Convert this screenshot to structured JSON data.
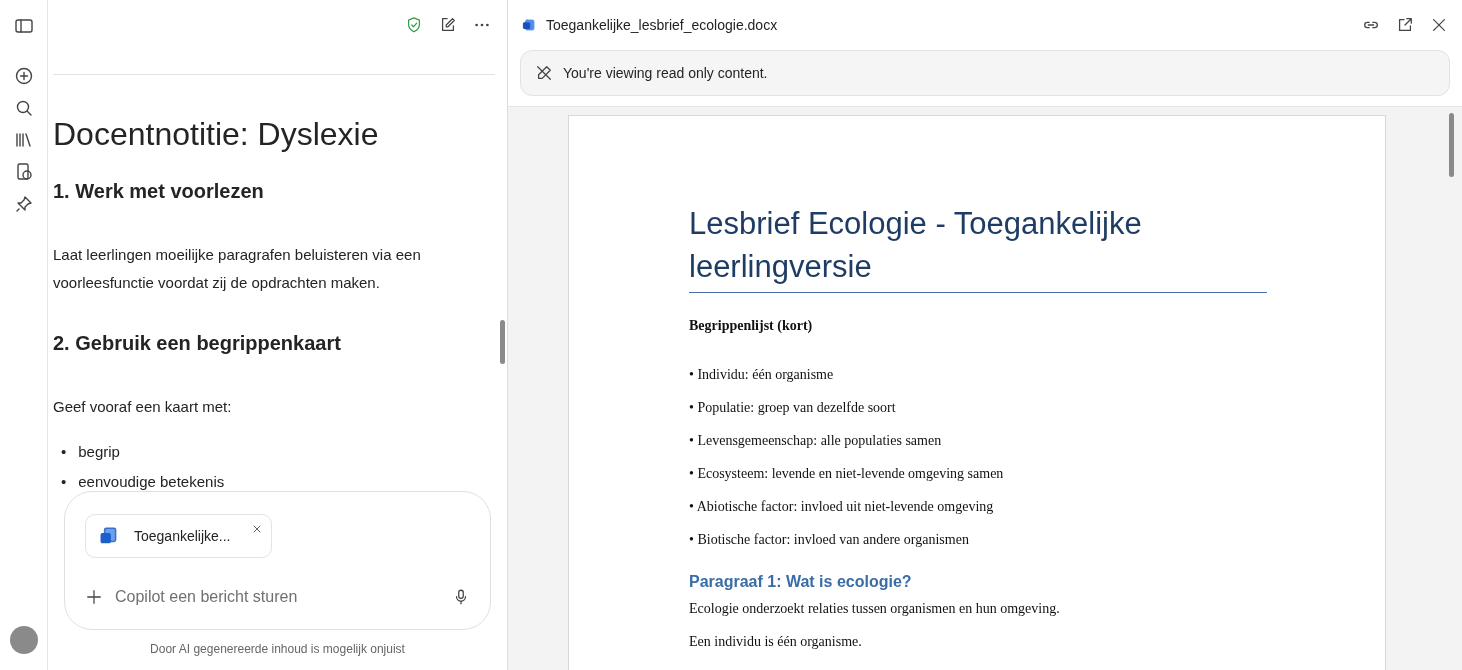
{
  "notes": {
    "title": "Docentnotitie: Dyslexie",
    "blocks": [
      {
        "kind": "heading",
        "text": "1. Werk met voorlezen"
      },
      {
        "kind": "paragraph",
        "text": "Laat leerlingen moeilijke paragrafen beluisteren via een voorleesfunctie voordat zij de opdrachten maken."
      },
      {
        "kind": "heading",
        "text": "2. Gebruik een begrippenkaart"
      },
      {
        "kind": "paragraph",
        "text": "Geef vooraf een kaart met:"
      },
      {
        "kind": "bullets",
        "marker": "•",
        "items": [
          "begrip",
          "eenvoudige betekenis"
        ]
      }
    ]
  },
  "composer": {
    "attachment": "Toegankelijke...",
    "placeholder": "Copilot een bericht sturen",
    "disclaimer": "Door AI gegenereerde inhoud is mogelijk onjuist"
  },
  "viewer": {
    "filename": "Toegankelijke_lesbrief_ecologie.docx",
    "banner": "You're viewing read only content.",
    "document": {
      "title": "Lesbrief Ecologie - Toegankelijke leerlingversie",
      "blocks": [
        {
          "kind": "bold",
          "text": "Begrippenlijst (kort)"
        },
        {
          "kind": "item",
          "text": "• Individu: één organisme"
        },
        {
          "kind": "item",
          "text": "• Populatie: groep van dezelfde soort"
        },
        {
          "kind": "item",
          "text": "• Levensgemeenschap: alle populaties samen"
        },
        {
          "kind": "item",
          "text": "• Ecosysteem: levende en niet-levende omgeving samen"
        },
        {
          "kind": "item",
          "text": "• Abiotische factor: invloed uit niet-levende omgeving"
        },
        {
          "kind": "item",
          "text": "• Biotische factor: invloed van andere organismen"
        },
        {
          "kind": "heading",
          "text": "Paragraaf 1: Wat is ecologie?"
        },
        {
          "kind": "body",
          "text": "Ecologie onderzoekt relaties tussen organismen en hun omgeving."
        },
        {
          "kind": "body",
          "text": "Een individu is één organisme."
        }
      ]
    }
  }
}
